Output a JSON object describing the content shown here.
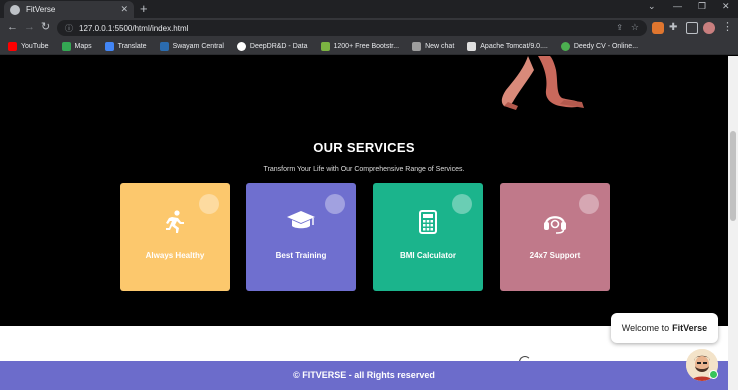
{
  "browser": {
    "tab_title": "FitVerse",
    "tab_close": "✕",
    "new_tab": "+",
    "url": "127.0.0.1:5500/html/index.html",
    "window_controls": [
      "⌄",
      "—",
      "❐",
      "✕"
    ],
    "bookmarks": [
      {
        "label": "YouTube",
        "color": "#ff0000"
      },
      {
        "label": "Maps",
        "color": "#34a853"
      },
      {
        "label": "Translate",
        "color": "#4285f4"
      },
      {
        "label": "Swayam Central",
        "color": "#2b6cb0"
      },
      {
        "label": "DeepDR&D - Data",
        "color": "#ffffff"
      },
      {
        "label": "1200+ Free Bootstr...",
        "color": "#7cb342"
      },
      {
        "label": "New chat",
        "color": "#9e9e9e"
      },
      {
        "label": "Apache Tomcat/9.0....",
        "color": "#e0e0e0"
      },
      {
        "label": "Deedy CV - Online...",
        "color": "#4caf50"
      }
    ]
  },
  "services": {
    "title": "OUR SERVICES",
    "subtitle": "Transform Your Life with Our Comprehensive Range of Services.",
    "cards": [
      {
        "label": "Always Healthy",
        "icon": "running-person-icon",
        "color": "#fcc86d"
      },
      {
        "label": "Best Training",
        "icon": "graduation-cap-icon",
        "color": "#6f6fcf"
      },
      {
        "label": "BMI Calculator",
        "icon": "calculator-icon",
        "color": "#1bb48c"
      },
      {
        "label": "24x7 Support",
        "icon": "headset-icon",
        "color": "#c0798a"
      }
    ]
  },
  "footer": {
    "text": "© FITVERSE - all Rights reserved"
  },
  "chat": {
    "prefix": "Welcome to",
    "brand": "FitVerse"
  }
}
